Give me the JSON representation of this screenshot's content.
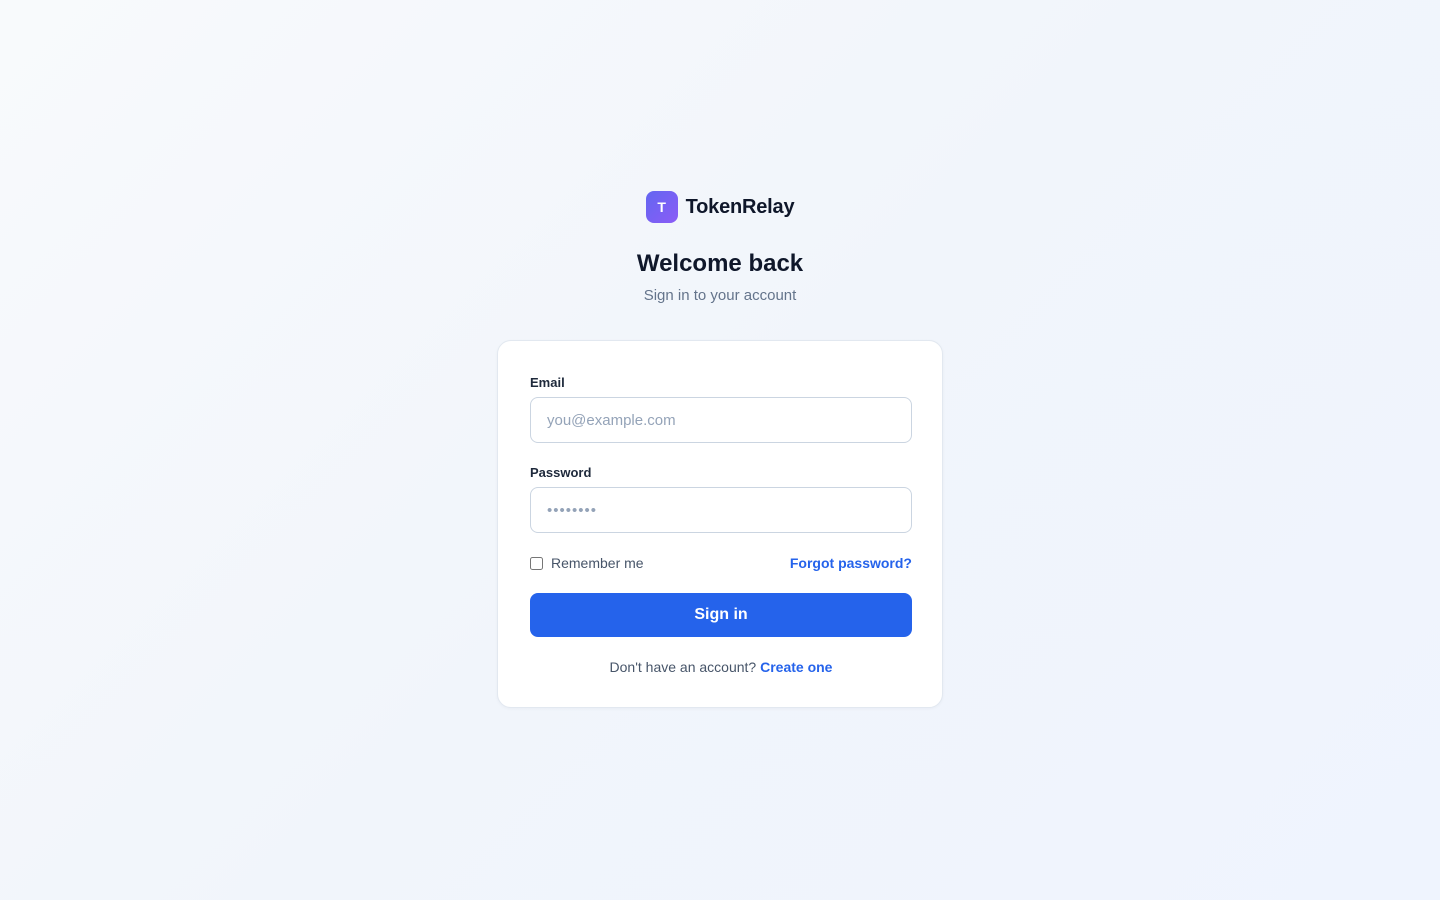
{
  "brand": {
    "logo_letter": "T",
    "logo_icon": "brand-logo-icon",
    "name": "TokenRelay"
  },
  "header": {
    "title": "Welcome back",
    "subtitle": "Sign in to your account"
  },
  "form": {
    "email": {
      "label": "Email",
      "placeholder": "you@example.com",
      "value": ""
    },
    "password": {
      "label": "Password",
      "placeholder": "••••••••",
      "value": ""
    },
    "remember_me": {
      "label": "Remember me",
      "checked": false
    },
    "forgot_password_label": "Forgot password?",
    "submit_label": "Sign in",
    "signup_prompt": "Don't have an account?",
    "signup_link_label": "Create one"
  },
  "colors": {
    "primary": "#2563eb",
    "logo_gradient_start": "#6366f1",
    "logo_gradient_end": "#8b5cf6",
    "text_primary": "#0f172a",
    "text_muted": "#64748b"
  }
}
